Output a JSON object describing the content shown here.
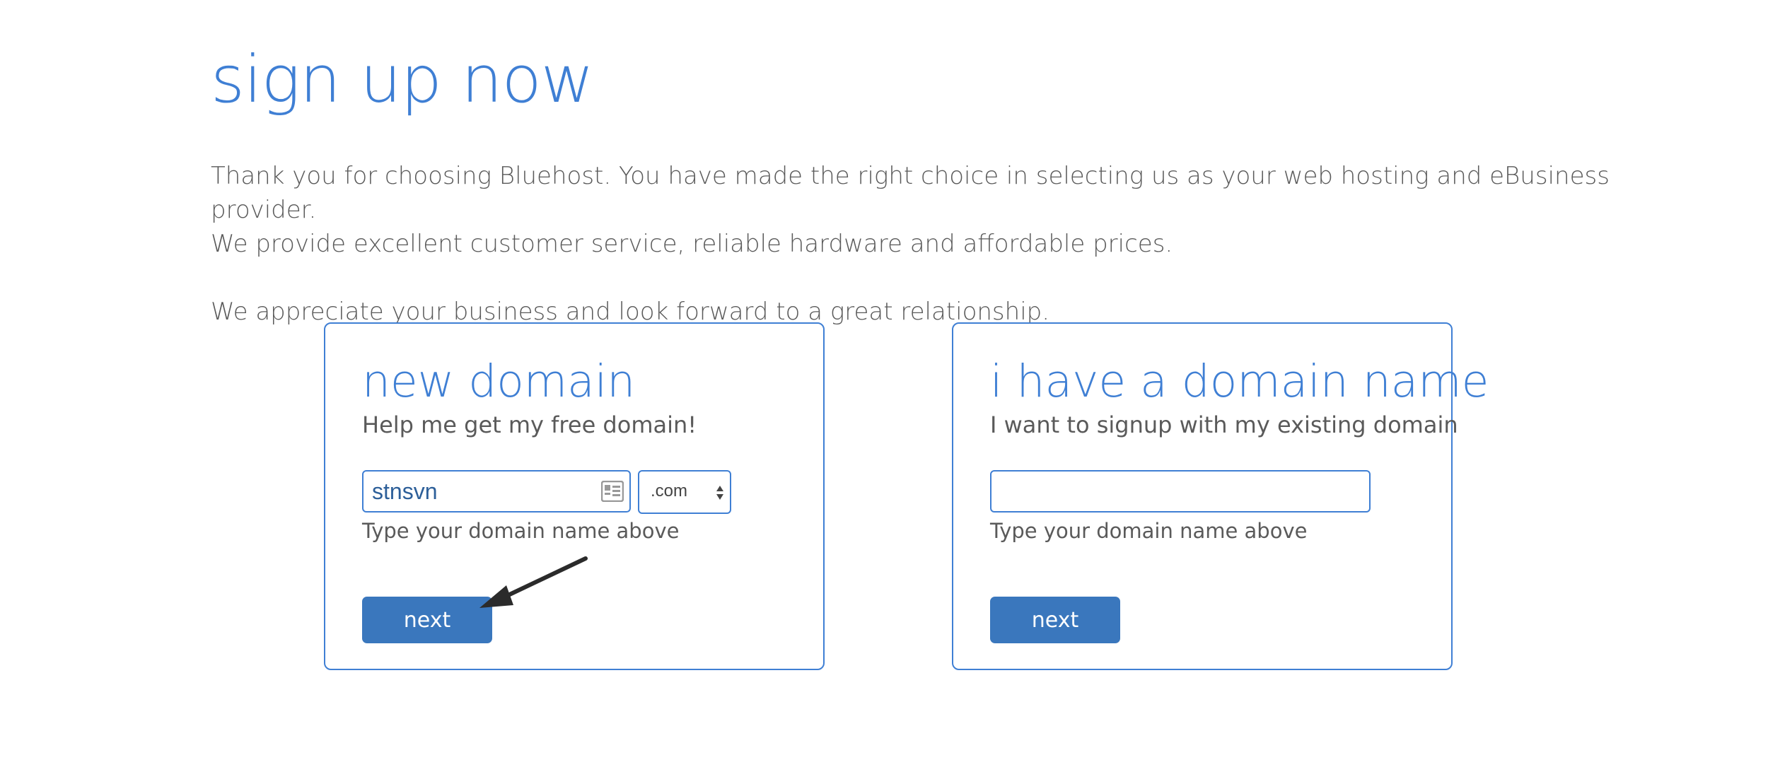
{
  "page": {
    "title": "sign up now",
    "intro_line1": "Thank you for choosing Bluehost. You have made the right choice in selecting us as your web hosting and eBusiness provider.",
    "intro_line2": "We provide excellent customer service, reliable hardware and affordable prices.",
    "intro_line3": "We appreciate your business and look forward to a great relationship."
  },
  "new_domain": {
    "title": "new domain",
    "subtitle": "Help me get my free domain!",
    "input_value": "stnsvn",
    "tld_selected": ".com",
    "hint": "Type your domain name above",
    "button_label": "next"
  },
  "existing_domain": {
    "title": "i have a domain name",
    "subtitle": "I want to signup with my existing domain",
    "input_value": "",
    "hint": "Type your domain name above",
    "button_label": "next"
  },
  "colors": {
    "accent": "#3f7fd4",
    "button": "#3a77bd",
    "text": "#5a5a5a",
    "annotation": "#2b2b2b"
  },
  "icons": {
    "input_icon": "autofill-contact-card-icon",
    "select_icon": "select-arrows-icon",
    "annotation": "annotation-arrow-icon"
  }
}
